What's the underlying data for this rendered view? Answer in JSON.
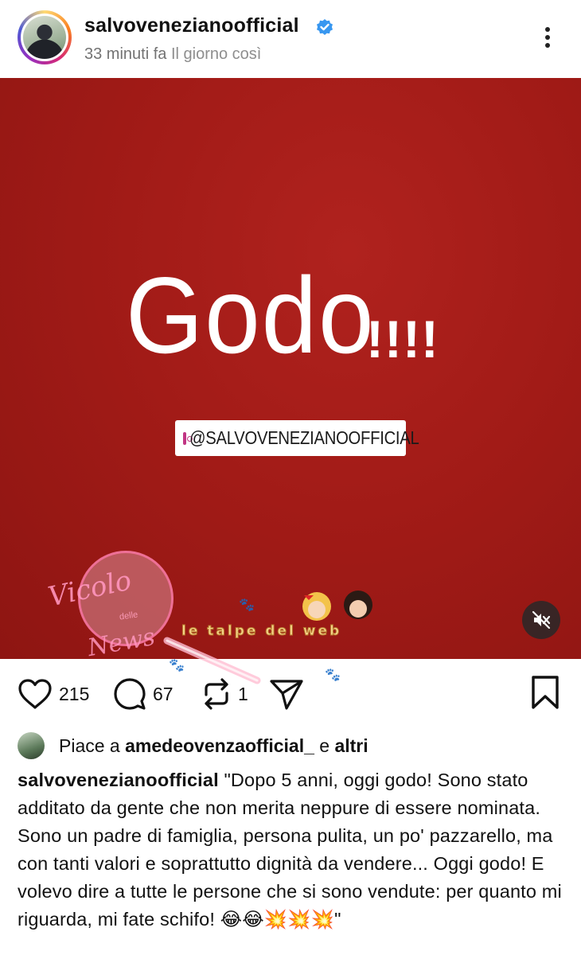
{
  "header": {
    "username": "salvovenezianoofficial",
    "subtitle_overlap": "33 minuti fa",
    "subtitle": "Il giorno così"
  },
  "post": {
    "headline": "Godo",
    "exclamations": "!!!!",
    "tag": "@SALVOVENEZIANOOFFICIAL",
    "watermark_left_1": "Vicolo",
    "watermark_left_small": "delle",
    "watermark_left_2": "News",
    "watermark_center": "le talpe del web"
  },
  "actions": {
    "likes_count": "215",
    "comments_count": "67",
    "reposts_count": "1"
  },
  "likes_line": {
    "prefix": "Piace a",
    "user": "amedeovenzaofficial_",
    "connector": "e",
    "others": "altri"
  },
  "caption": {
    "author": "salvovenezianoofficial",
    "text": "\"Dopo 5 anni, oggi godo! Sono stato additato da gente che non merita neppure di essere nominata. Sono un padre di famiglia, persona pulita, un po' pazzarello, ma con tanti valori e soprattutto dignità da vendere... Oggi godo! E volevo dire  a tutte le persone che si sono vendute: per quanto mi riguarda, mi fate schifo! 😂😂💥💥💥\""
  },
  "colors": {
    "post_background": "#a21b17",
    "verified_blue": "#3897f0",
    "muted_text": "#8e8e8e"
  }
}
